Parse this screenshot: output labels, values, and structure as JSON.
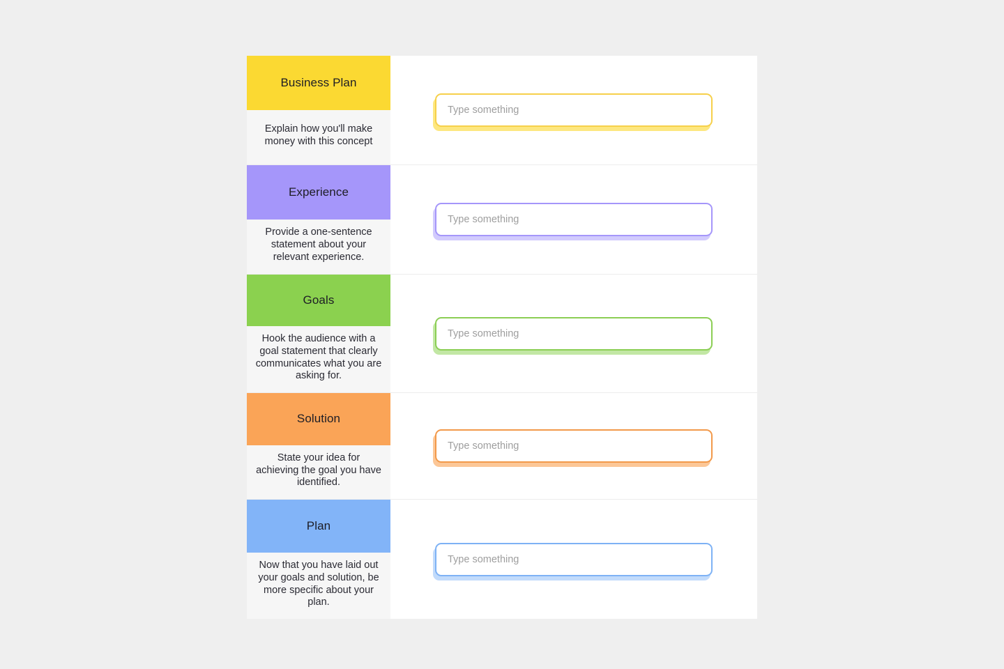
{
  "page": {
    "background_color": "#efefef",
    "card_background": "#ffffff",
    "left_column_background": "#f6f6f6",
    "divider_color": "#ededed"
  },
  "input_defaults": {
    "placeholder": "Type something",
    "value": ""
  },
  "sections": [
    {
      "id": "business-plan",
      "title": "Business Plan",
      "description": "Explain how you'll make money with this concept",
      "color": "#fbd932",
      "border_color": "#f6d04a",
      "shadow_color": "#fbd932",
      "input": {
        "placeholder": "Type something",
        "value": ""
      }
    },
    {
      "id": "experience",
      "title": "Experience",
      "description": "Provide a one-sentence statement about your relevant experience.",
      "color": "#a596fa",
      "border_color": "#a596fa",
      "shadow_color": "#b7abfb",
      "input": {
        "placeholder": "Type something",
        "value": ""
      }
    },
    {
      "id": "goals",
      "title": "Goals",
      "description": "Hook the audience with a goal statement that clearly communicates what you are asking for.",
      "color": "#8bd14f",
      "border_color": "#8bce54",
      "shadow_color": "#9dd96c",
      "input": {
        "placeholder": "Type something",
        "value": ""
      }
    },
    {
      "id": "solution",
      "title": "Solution",
      "description": "State your idea for achieving the goal you have identified.",
      "color": "#faa457",
      "border_color": "#f2994a",
      "shadow_color": "#faa457",
      "input": {
        "placeholder": "Type something",
        "value": ""
      }
    },
    {
      "id": "plan",
      "title": "Plan",
      "description": "Now that you have laid out your goals and solution, be more specific about your plan.",
      "color": "#82b4f8",
      "border_color": "#7eb2f5",
      "shadow_color": "#9cc5f9",
      "input": {
        "placeholder": "Type something",
        "value": ""
      }
    }
  ]
}
